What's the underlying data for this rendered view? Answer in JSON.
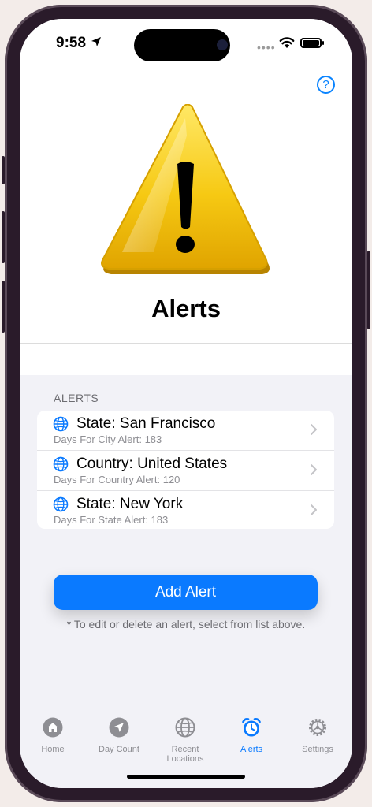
{
  "status": {
    "time": "9:58",
    "dots": "••••"
  },
  "page": {
    "title": "Alerts",
    "help_symbol": "?"
  },
  "alerts": {
    "section_header": "ALERTS",
    "items": [
      {
        "title": "State: San Francisco",
        "subtitle": "Days For City Alert: 183"
      },
      {
        "title": "Country: United States",
        "subtitle": "Days For Country Alert: 120"
      },
      {
        "title": "State: New York",
        "subtitle": "Days For State Alert: 183"
      }
    ]
  },
  "actions": {
    "add_alert_label": "Add Alert",
    "note": "* To edit or delete an alert, select from list above."
  },
  "tabbar": {
    "tabs": [
      {
        "label": "Home",
        "icon": "house-icon"
      },
      {
        "label": "Day Count",
        "icon": "location-arrow-icon"
      },
      {
        "label": "Recent Locations",
        "icon": "globe-icon"
      },
      {
        "label": "Alerts",
        "icon": "alarm-clock-icon",
        "active": true
      },
      {
        "label": "Settings",
        "icon": "gear-icon"
      }
    ]
  },
  "colors": {
    "accent": "#0a7aff",
    "warning_yellow": "#f4c20d",
    "inactive": "#8e8e93"
  }
}
